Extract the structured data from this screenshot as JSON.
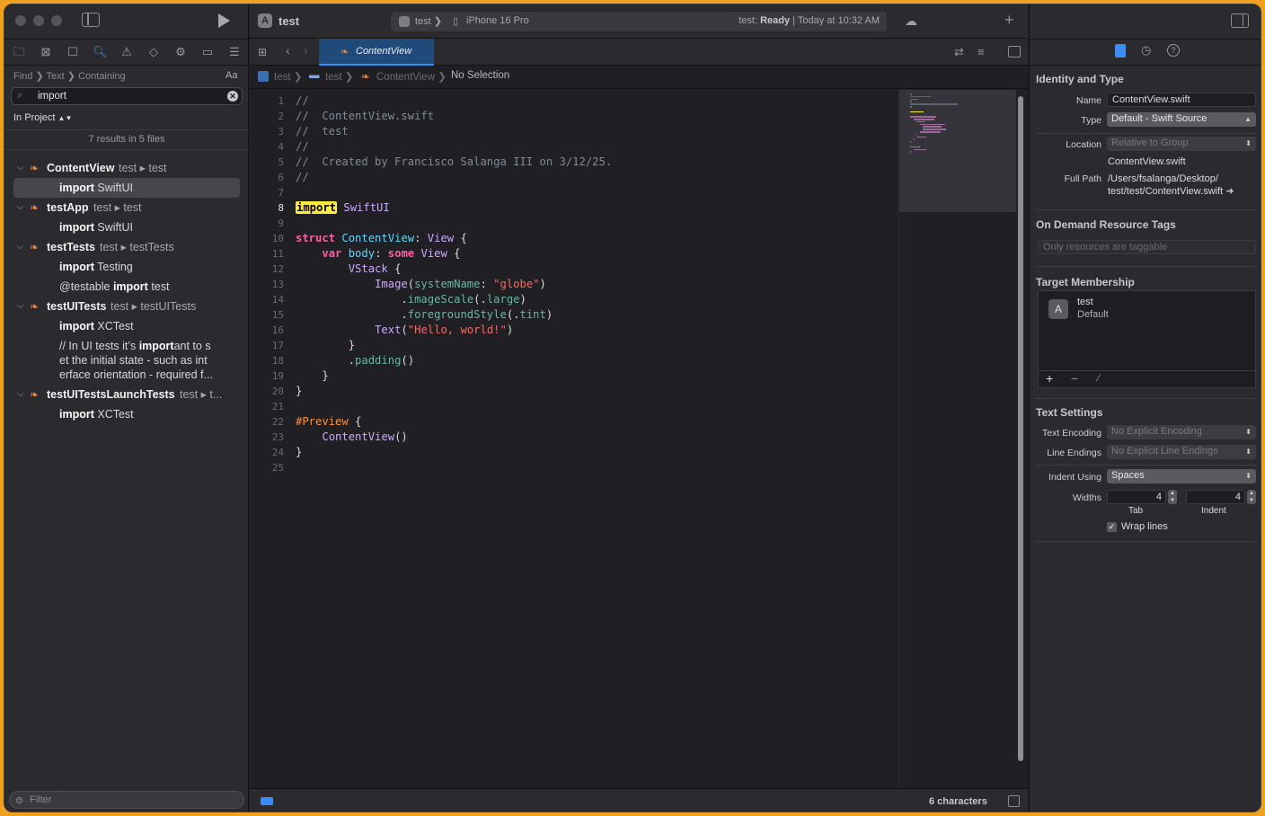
{
  "scheme": {
    "project": "test",
    "breadcrumb_project": "test",
    "device": "iPhone 16 Pro",
    "status_prefix": "test: ",
    "status": "Ready",
    "status_time": "Today at 10:32 AM"
  },
  "find": {
    "crumbs": [
      "Find",
      "Text",
      "Containing"
    ],
    "case_label": "Aa",
    "query": "import",
    "scope": "In Project",
    "results_summary": "7 results in 5 files",
    "filter_placeholder": "Filter"
  },
  "results": [
    {
      "file": "ContentView",
      "path": "test ▸ test",
      "matches": [
        {
          "pre": "",
          "hit": "import",
          "post": " SwiftUI",
          "selected": true
        }
      ]
    },
    {
      "file": "testApp",
      "path": "test ▸ test",
      "matches": [
        {
          "pre": "",
          "hit": "import",
          "post": " SwiftUI"
        }
      ]
    },
    {
      "file": "testTests",
      "path": "test ▸ testTests",
      "matches": [
        {
          "pre": "",
          "hit": "import",
          "post": " Testing"
        },
        {
          "pre": "@testable ",
          "hit": "import",
          "post": " test"
        }
      ]
    },
    {
      "file": "testUITests",
      "path": "test ▸ testUITests",
      "matches": [
        {
          "pre": "",
          "hit": "import",
          "post": " XCTest"
        },
        {
          "lines": [
            "// In UI tests it’s |import|ant to s",
            "et the initial state - such as int",
            "erface orientation - required f..."
          ]
        }
      ]
    },
    {
      "file": "testUITestsLaunchTests",
      "path": "test ▸ t...",
      "matches": [
        {
          "pre": "",
          "hit": "import",
          "post": " XCTest"
        }
      ]
    }
  ],
  "editor": {
    "tab": "ContentView",
    "jump": [
      "test",
      "test",
      "ContentView",
      "No Selection"
    ],
    "status_right": "6 characters"
  },
  "code": [
    "//",
    "//  ContentView.swift",
    "//  test",
    "//",
    "//  Created by Francisco Salanga III on 3/12/25.",
    "//",
    "",
    "import SwiftUI",
    "",
    "struct ContentView: View {",
    "    var body: some View {",
    "        VStack {",
    "            Image(systemName: \"globe\")",
    "                .imageScale(.large)",
    "                .foregroundStyle(.tint)",
    "            Text(\"Hello, world!\")",
    "        }",
    "        .padding()",
    "    }",
    "}",
    "",
    "#Preview {",
    "    ContentView()",
    "}",
    ""
  ],
  "inspector": {
    "identity_title": "Identity and Type",
    "name_label": "Name",
    "name_value": "ContentView.swift",
    "type_label": "Type",
    "type_value": "Default - Swift Source",
    "location_label": "Location",
    "location_value": "Relative to Group",
    "location_file": "ContentView.swift",
    "fullpath_label": "Full Path",
    "fullpath_1": "/Users/fsalanga/Desktop/",
    "fullpath_2": "test/test/ContentView.swift",
    "odr_title": "On Demand Resource Tags",
    "odr_placeholder": "Only resources are taggable",
    "target_title": "Target Membership",
    "target_name": "test",
    "target_sub": "Default",
    "text_title": "Text Settings",
    "encoding_label": "Text Encoding",
    "encoding_value": "No Explicit Encoding",
    "endings_label": "Line Endings",
    "endings_value": "No Explicit Line Endings",
    "indent_label": "Indent Using",
    "indent_value": "Spaces",
    "widths_label": "Widths",
    "tab_value": "4",
    "indent_width_value": "4",
    "tab_caption": "Tab",
    "indent_caption": "Indent",
    "wrap_label": "Wrap lines"
  }
}
